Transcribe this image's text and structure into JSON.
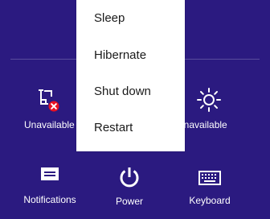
{
  "settings_panel": {
    "tiles_top": [
      {
        "label": "Unavailable",
        "icon": "network-unavailable-icon"
      },
      {
        "label": "Unavailable",
        "icon": "brightness-icon"
      }
    ],
    "tiles_bottom": [
      {
        "label": "Notifications",
        "icon": "notifications-icon"
      },
      {
        "label": "Power",
        "icon": "power-icon"
      },
      {
        "label": "Keyboard",
        "icon": "keyboard-icon"
      }
    ]
  },
  "power_menu": {
    "items": [
      "Sleep",
      "Hibernate",
      "Shut down",
      "Restart"
    ]
  },
  "colors": {
    "background": "#2b1a80",
    "menu_background": "#ffffff",
    "menu_text": "#1a1a1a",
    "error_badge": "#e81123"
  }
}
